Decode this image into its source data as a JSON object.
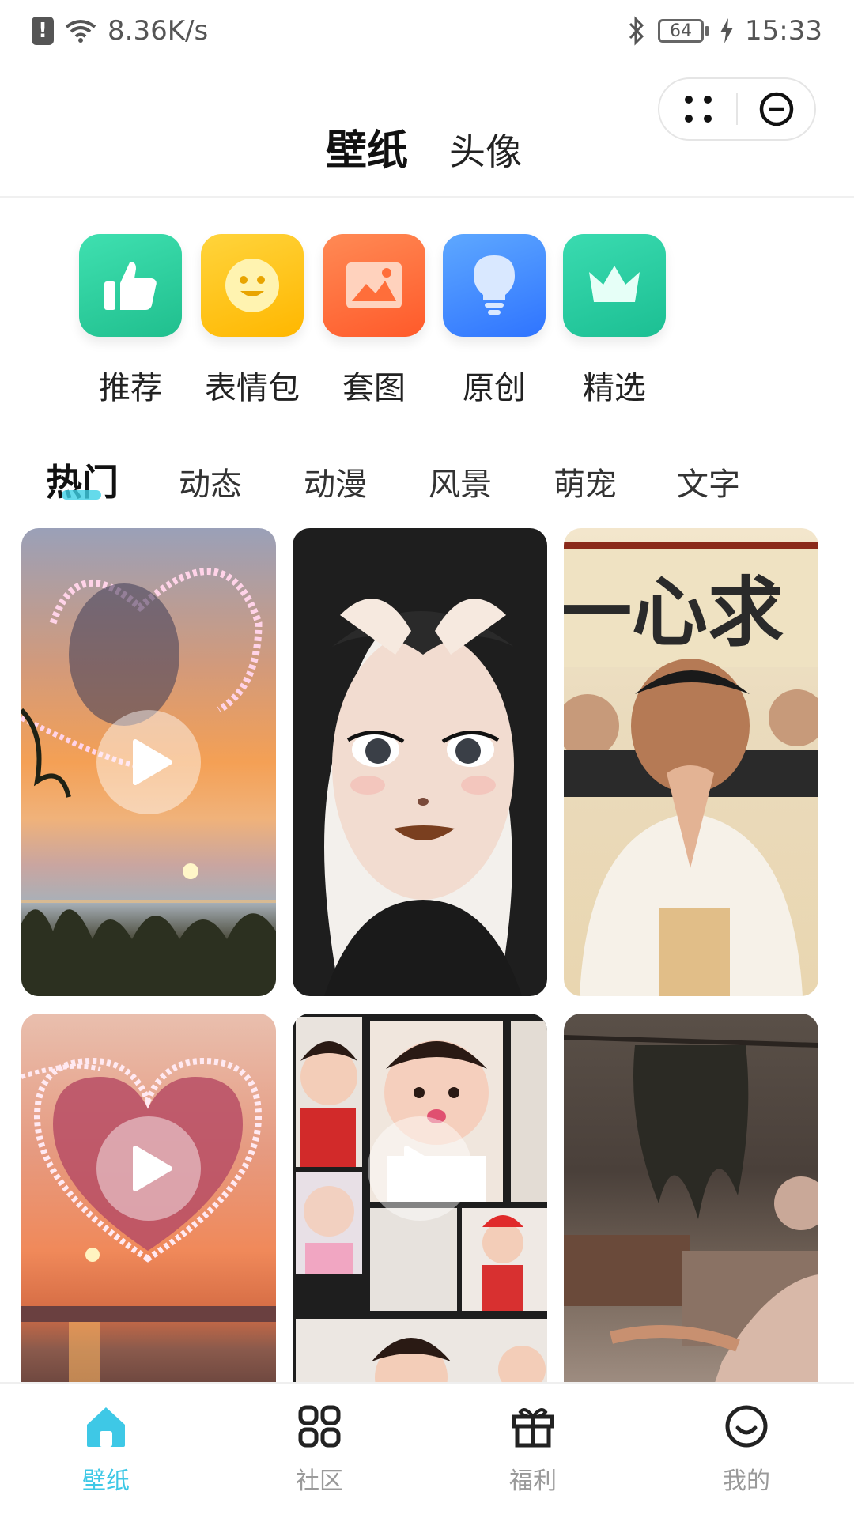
{
  "status_bar": {
    "net_speed": "8.36K/s",
    "battery": "64",
    "time": "15:33",
    "icons": [
      "alert-icon",
      "wifi-icon",
      "bluetooth-icon",
      "battery-icon",
      "charging-icon"
    ]
  },
  "header": {
    "tabs": [
      {
        "label": "壁纸",
        "active": true
      },
      {
        "label": "头像",
        "active": false
      }
    ]
  },
  "categories": [
    {
      "label": "推荐",
      "icon": "thumbs-up-icon",
      "color": "#2fcf9c"
    },
    {
      "label": "表情包",
      "icon": "smiley-icon",
      "color": "#ffc21a"
    },
    {
      "label": "套图",
      "icon": "image-icon",
      "color": "#ff6e3a"
    },
    {
      "label": "原创",
      "icon": "lightbulb-icon",
      "color": "#3d8bff"
    },
    {
      "label": "精选",
      "icon": "crown-icon",
      "color": "#22c9a0"
    }
  ],
  "subtabs": [
    {
      "label": "热门",
      "active": true
    },
    {
      "label": "动态",
      "active": false
    },
    {
      "label": "动漫",
      "active": false
    },
    {
      "label": "风景",
      "active": false
    },
    {
      "label": "萌宠",
      "active": false
    },
    {
      "label": "文字",
      "active": false
    }
  ],
  "wallpapers": [
    {
      "name": "sunset-heart-video",
      "has_play": true
    },
    {
      "name": "anime-girl",
      "has_play": false
    },
    {
      "name": "praying-man-meme",
      "has_play": false
    },
    {
      "name": "pink-heart-video",
      "has_play": true
    },
    {
      "name": "baby-collage-video",
      "has_play": true
    },
    {
      "name": "dark-scene",
      "has_play": false
    }
  ],
  "bottom_nav": [
    {
      "label": "壁纸",
      "icon": "home-icon",
      "active": true
    },
    {
      "label": "社区",
      "icon": "grid-icon",
      "active": false
    },
    {
      "label": "福利",
      "icon": "gift-icon",
      "active": false
    },
    {
      "label": "我的",
      "icon": "smile-face-icon",
      "active": false
    }
  ],
  "colors": {
    "accent": "#3ec8e6",
    "inactive": "#9a9a9a"
  }
}
